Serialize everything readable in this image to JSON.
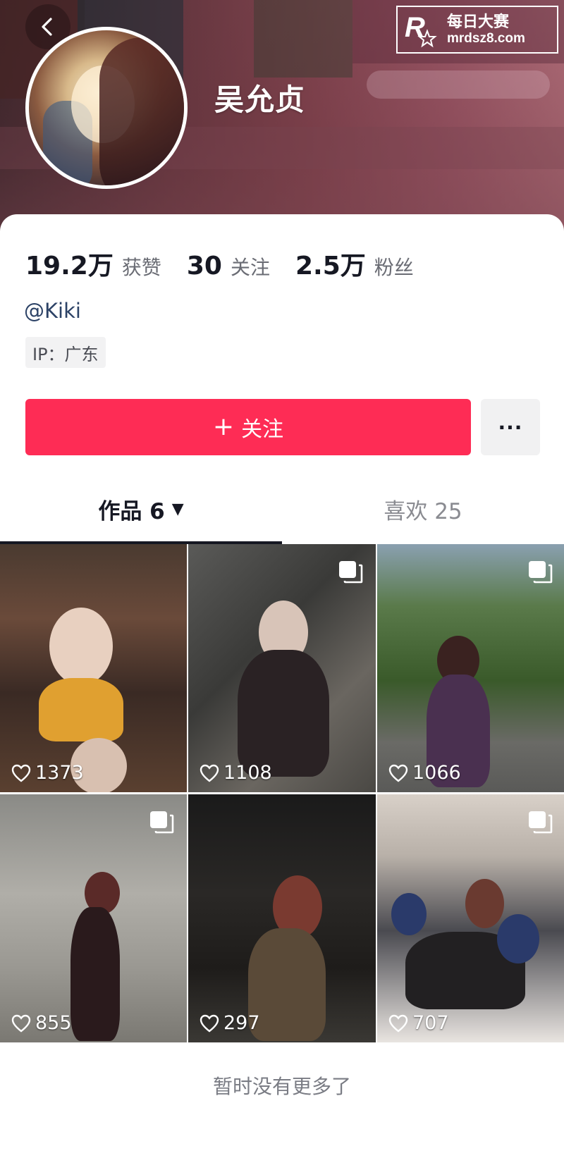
{
  "watermark": {
    "brand_top": "每日大赛",
    "brand_url": "mrdsz8.com",
    "logo_letter": "R"
  },
  "profile": {
    "name": "吴允贞",
    "stats": [
      {
        "value": "19.2万",
        "label": "获赞"
      },
      {
        "value": "30",
        "label": "关注"
      },
      {
        "value": "2.5万",
        "label": "粉丝"
      }
    ],
    "handle": "@Kiki",
    "ip": "IP：广东"
  },
  "actions": {
    "follow_label": "关注",
    "follow_plus": "+",
    "more_label": "···"
  },
  "tabs": [
    {
      "label": "作品 6",
      "caret": "▼",
      "active": true
    },
    {
      "label": "喜欢 25",
      "active": false
    }
  ],
  "videos": [
    {
      "likes": "1373",
      "multi": false
    },
    {
      "likes": "1108",
      "multi": true
    },
    {
      "likes": "1066",
      "multi": true
    },
    {
      "likes": "855",
      "multi": true
    },
    {
      "likes": "297",
      "multi": false
    },
    {
      "likes": "707",
      "multi": true
    }
  ],
  "footer": {
    "note": "暂时没有更多了"
  },
  "colors": {
    "accent": "#fe2c55",
    "text": "#161823",
    "secondary": "#6a6c74"
  }
}
